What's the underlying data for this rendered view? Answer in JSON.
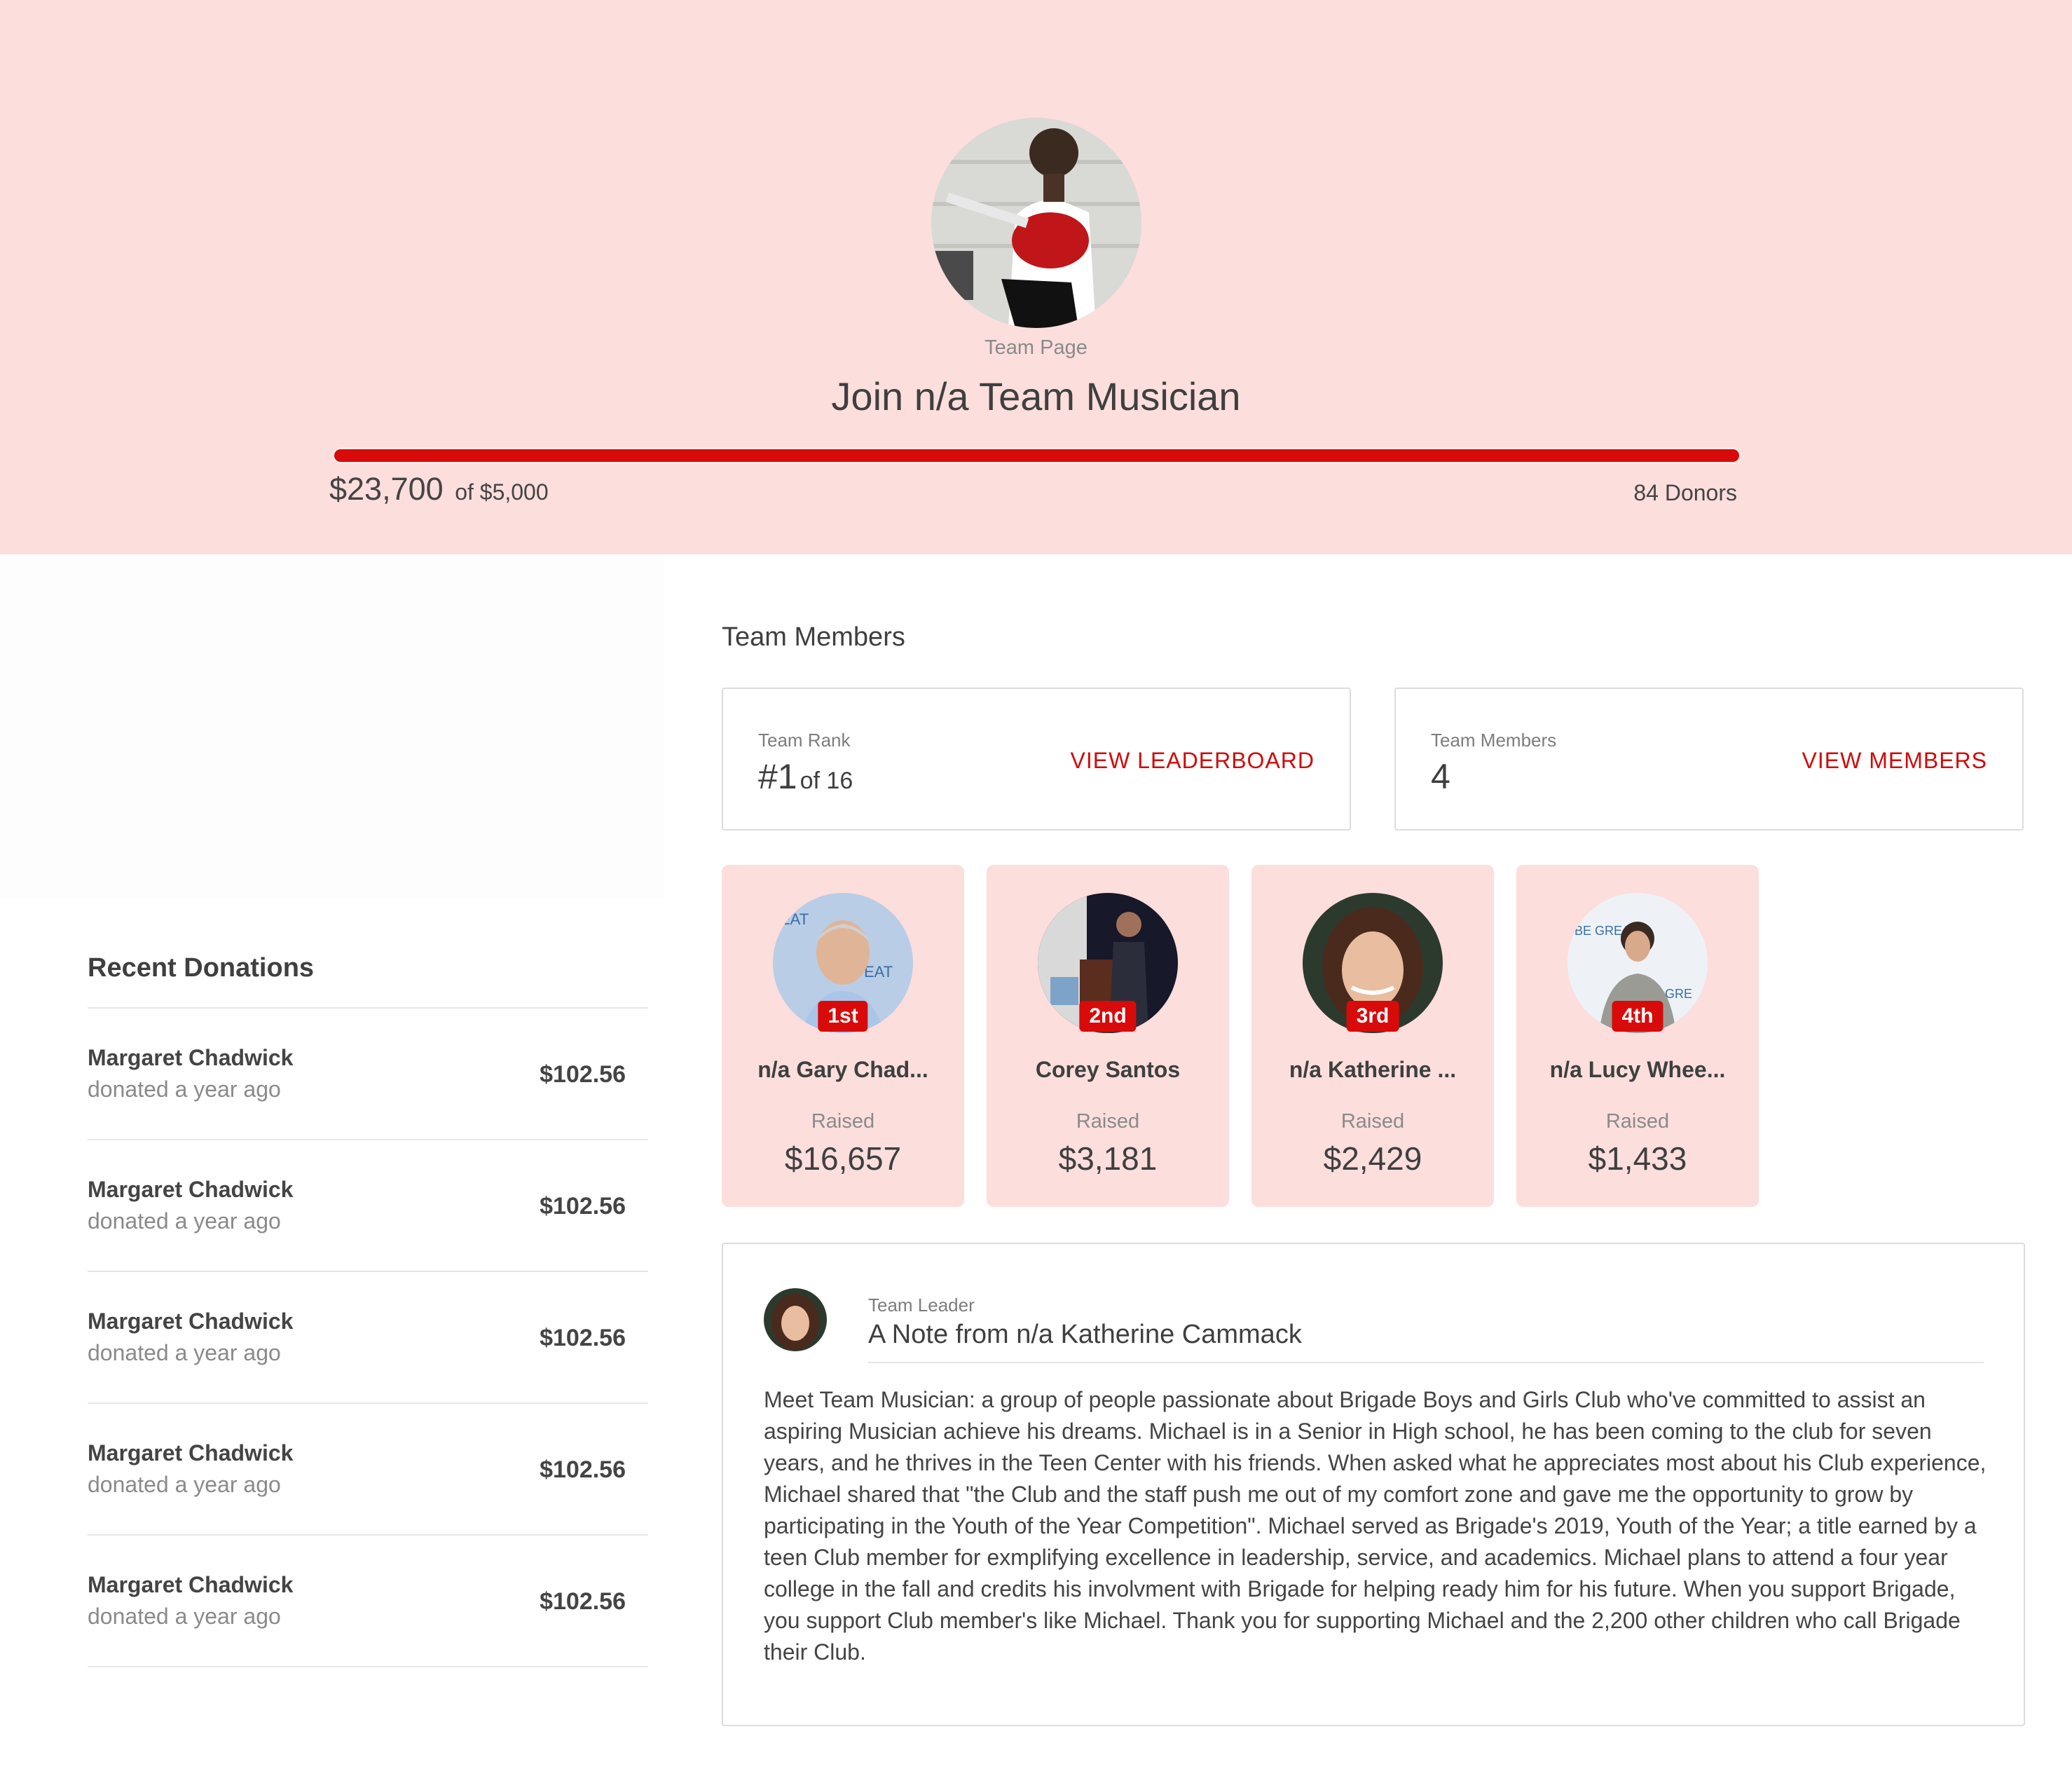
{
  "hero": {
    "subtitle": "Team Page",
    "title": "Join n/a Team Musician",
    "raised": "$23,700",
    "goal_text": "of $5,000",
    "progress_fraction": 1.0,
    "donors": "84 Donors",
    "background": "#fcdedd",
    "accent": "#d90a0a"
  },
  "recent_donations": {
    "title": "Recent Donations",
    "items": [
      {
        "name": "Margaret Chadwick",
        "when": "donated a year ago",
        "amount": "$102.56"
      },
      {
        "name": "Margaret Chadwick",
        "when": "donated a year ago",
        "amount": "$102.56"
      },
      {
        "name": "Margaret Chadwick",
        "when": "donated a year ago",
        "amount": "$102.56"
      },
      {
        "name": "Margaret Chadwick",
        "when": "donated a year ago",
        "amount": "$102.56"
      },
      {
        "name": "Margaret Chadwick",
        "when": "donated a year ago",
        "amount": "$102.56"
      }
    ]
  },
  "team_members": {
    "heading": "Team Members",
    "rank_box": {
      "label": "Team Rank",
      "value": "#1",
      "suffix": "of 16",
      "link": "VIEW LEADERBOARD"
    },
    "members_box": {
      "label": "Team Members",
      "value": "4",
      "link": "VIEW MEMBERS"
    },
    "cards": [
      {
        "rank": "1st",
        "name": "n/a Gary Chad...",
        "raised_label": "Raised",
        "raised": "$16,657"
      },
      {
        "rank": "2nd",
        "name": "Corey Santos",
        "raised_label": "Raised",
        "raised": "$3,181"
      },
      {
        "rank": "3rd",
        "name": "n/a Katherine ...",
        "raised_label": "Raised",
        "raised": "$2,429"
      },
      {
        "rank": "4th",
        "name": "n/a Lucy Whee...",
        "raised_label": "Raised",
        "raised": "$1,433"
      }
    ]
  },
  "note": {
    "label": "Team Leader",
    "title": "A Note from n/a Katherine Cammack",
    "body": "Meet Team Musician: a group of people passionate about Brigade Boys and Girls Club who've committed to assist an aspiring Musician achieve his dreams. Michael is in a Senior in High school, he has been coming to the club for seven years, and he thrives in the Teen Center with his friends. When asked what he appreciates most about his Club experience, Michael shared that \"the Club and the staff push me out of my comfort zone and gave me the opportunity to grow by participating in the Youth of the Year Competition\". Michael served as Brigade's 2019, Youth of the Year; a title earned by a teen Club member for exmplifying excellence in leadership, service, and academics. Michael plans to attend a four year college in the fall and credits his involvment with Brigade for helping ready him for his future. When you support Brigade, you support Club member's like Michael. Thank you for supporting Michael and the 2,200 other children who call Brigade their Club."
  }
}
